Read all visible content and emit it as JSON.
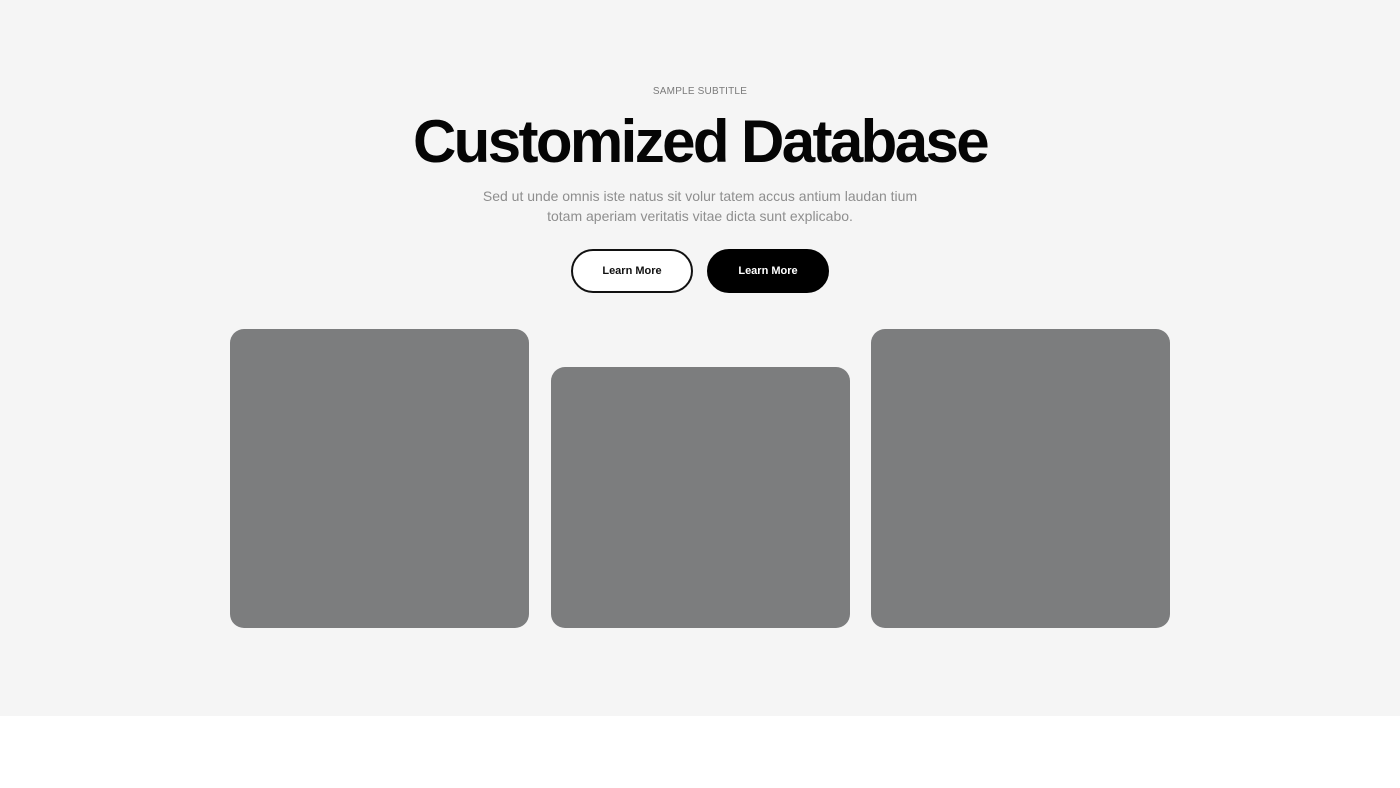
{
  "hero": {
    "subtitle": "SAMPLE SUBTITLE",
    "title": "Customized Database",
    "description": "Sed ut unde omnis iste natus sit volur tatem accus antium laudan tium totam aperiam veritatis vitae dicta sunt explicabo.",
    "buttons": {
      "outline_label": "Learn More",
      "solid_label": "Learn More"
    }
  },
  "colors": {
    "hero_background": "#f5f5f5",
    "card_placeholder": "#7c7d7e",
    "primary_button": "#000000",
    "title_text": "#050505",
    "muted_text": "#8e8e8e"
  }
}
